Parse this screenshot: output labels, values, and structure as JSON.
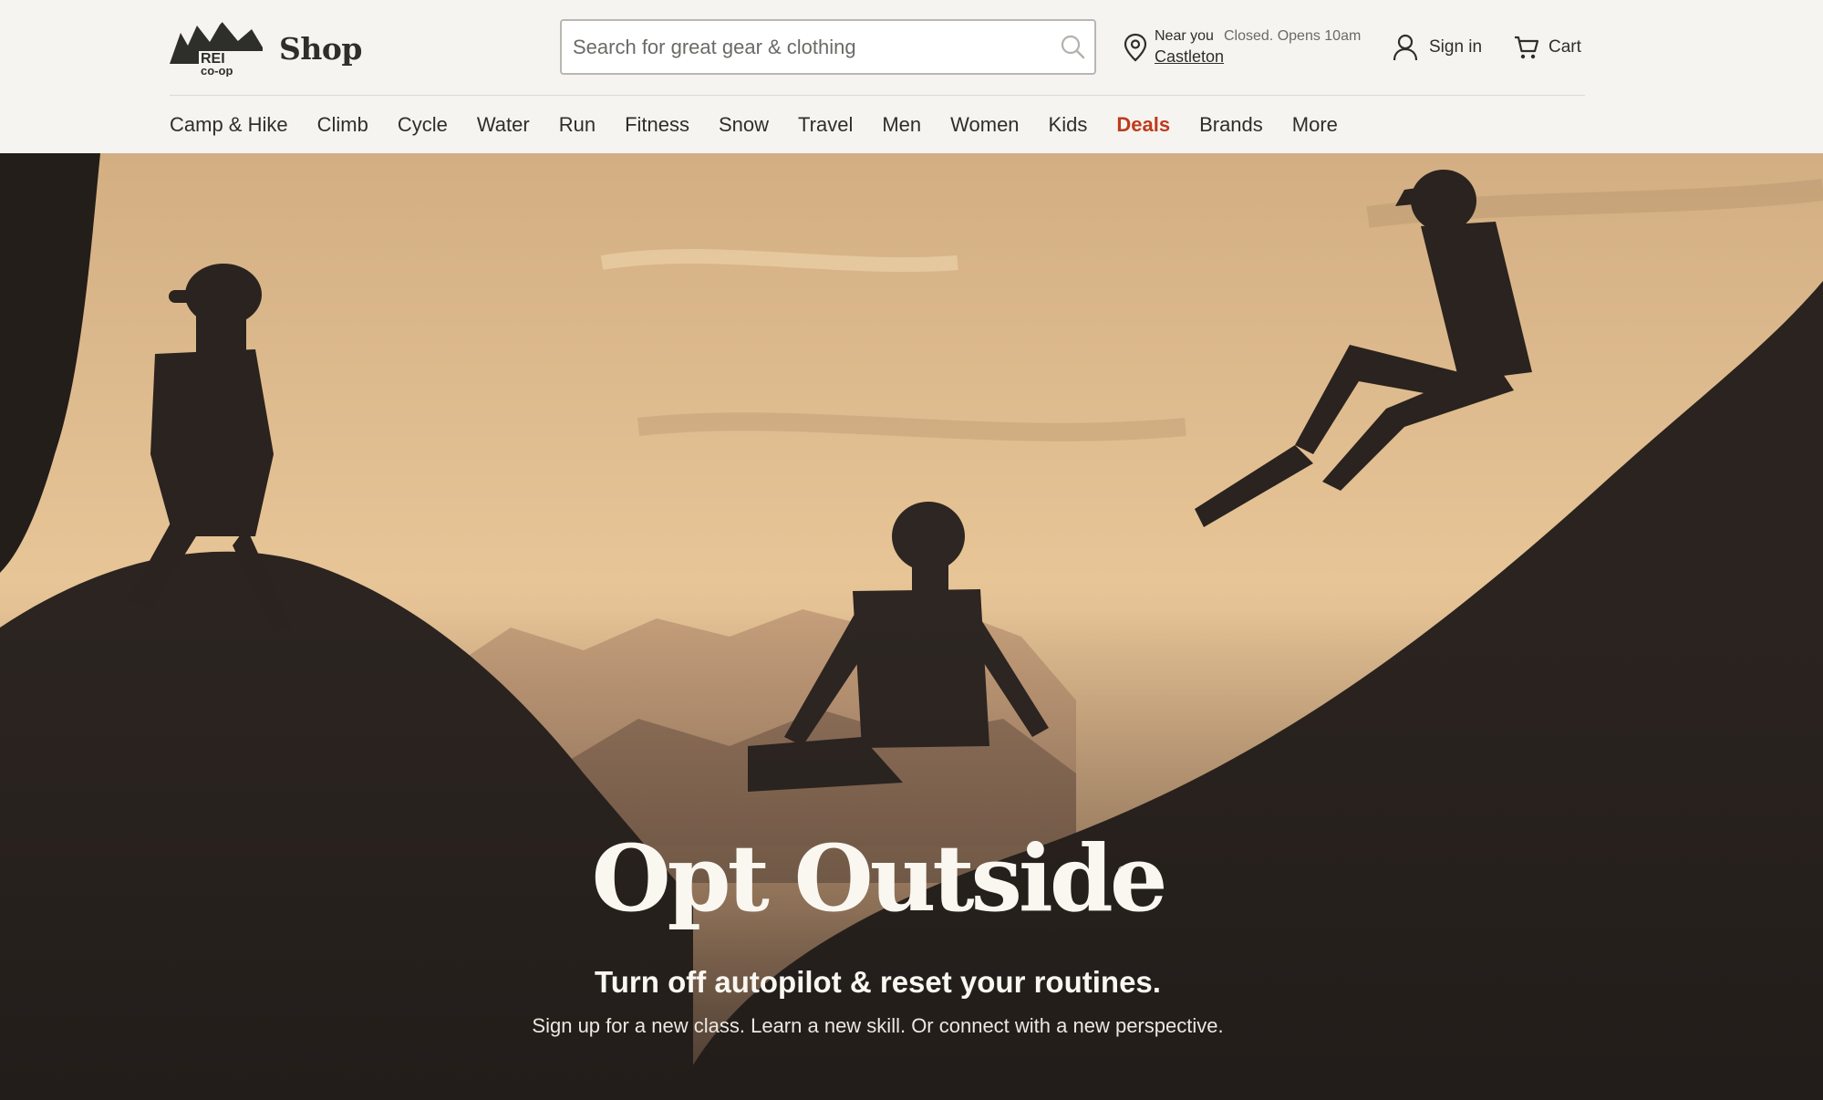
{
  "header": {
    "logo_alt": "REI co-op",
    "shop_label": "Shop",
    "search": {
      "placeholder": "Search for great gear & clothing",
      "value": ""
    },
    "store": {
      "near_label": "Near you",
      "status": "Closed. Opens 10am",
      "name": "Castleton"
    },
    "signin_label": "Sign in",
    "cart_label": "Cart"
  },
  "nav": {
    "items": [
      "Camp & Hike",
      "Climb",
      "Cycle",
      "Water",
      "Run",
      "Fitness",
      "Snow",
      "Travel",
      "Men",
      "Women",
      "Kids",
      "Deals",
      "Brands",
      "More"
    ],
    "highlight_index": 11
  },
  "hero": {
    "title": "Opt Outside",
    "reg_mark": "®",
    "subtitle": "Turn off autopilot & reset your routines.",
    "body": "Sign up for a new class. Learn a new skill. Or connect with a new perspective."
  },
  "colors": {
    "header_bg": "#f5f4f0",
    "text": "#2e2e2b",
    "deals": "#c03a1c",
    "hero_sky_top": "#d2ae82",
    "hero_dark": "#221d1a"
  },
  "icons": {
    "logo": "rei-coop-logo",
    "search": "search-icon",
    "location": "map-pin-icon",
    "account": "user-icon",
    "cart": "cart-icon"
  }
}
